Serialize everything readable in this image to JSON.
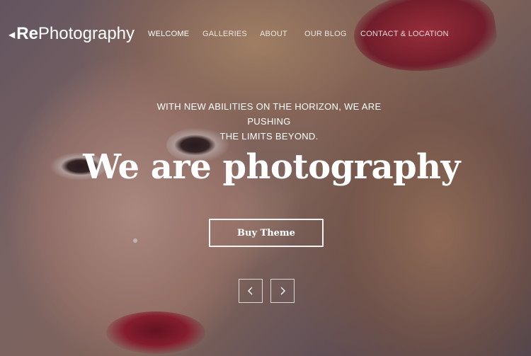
{
  "header": {
    "logo_bold": "Re",
    "logo_light": "Photography",
    "nav": [
      {
        "label": "WELCOME",
        "active": true
      },
      {
        "label": "GALLERIES",
        "active": false
      },
      {
        "label": "ABOUT",
        "active": false
      },
      {
        "label": "OUR BLOG",
        "active": false
      },
      {
        "label": "CONTACT & LOCATION",
        "active": false
      }
    ]
  },
  "hero": {
    "tagline_line1": "WITH NEW ABILITIES ON THE HORIZON, WE ARE PUSHING",
    "tagline_line2": "THE LIMITS BEYOND.",
    "headline": "We are photography",
    "cta_label": "Buy Theme",
    "prev_icon": "chevron-left-icon",
    "next_icon": "chevron-right-icon"
  },
  "colors": {
    "text": "#ffffff",
    "accent_lips": "#a81e2e"
  }
}
